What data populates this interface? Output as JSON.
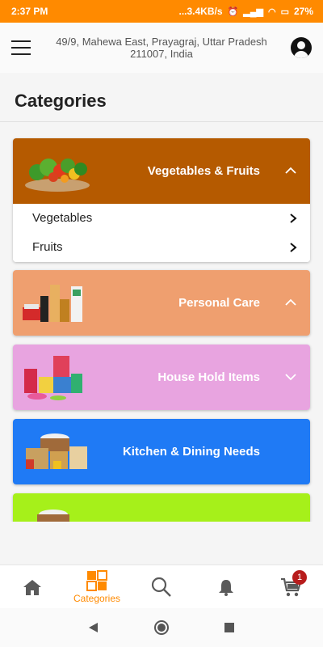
{
  "status_bar": {
    "time": "2:37 PM",
    "network_speed": "...3.4KB/s",
    "battery": "27%"
  },
  "header": {
    "address_line1": "49/9, Mahewa East, Prayagraj, Uttar Pradesh",
    "address_line2": "211007, India"
  },
  "page": {
    "title": "Categories"
  },
  "categories": [
    {
      "name": "Vegetables & Fruits",
      "color": "#b55a00",
      "expanded": true,
      "subcategories": [
        "Vegetables",
        "Fruits"
      ]
    },
    {
      "name": "Personal Care",
      "color": "#ef9f6f",
      "expanded": false
    },
    {
      "name": "House Hold Items",
      "color": "#e8a4e0",
      "expanded": false
    },
    {
      "name": "Kitchen & Dining Needs",
      "color": "#1f7af5",
      "expanded": false
    },
    {
      "name": "",
      "color": "#a6f01a",
      "expanded": false
    }
  ],
  "bottom_nav": {
    "items": [
      {
        "icon": "home-icon",
        "label": ""
      },
      {
        "icon": "categories-icon",
        "label": "Categories",
        "active": true
      },
      {
        "icon": "search-icon",
        "label": ""
      },
      {
        "icon": "bell-icon",
        "label": ""
      },
      {
        "icon": "cart-icon",
        "label": ""
      }
    ],
    "cart_count": "1",
    "accent": "#ff8a00"
  }
}
